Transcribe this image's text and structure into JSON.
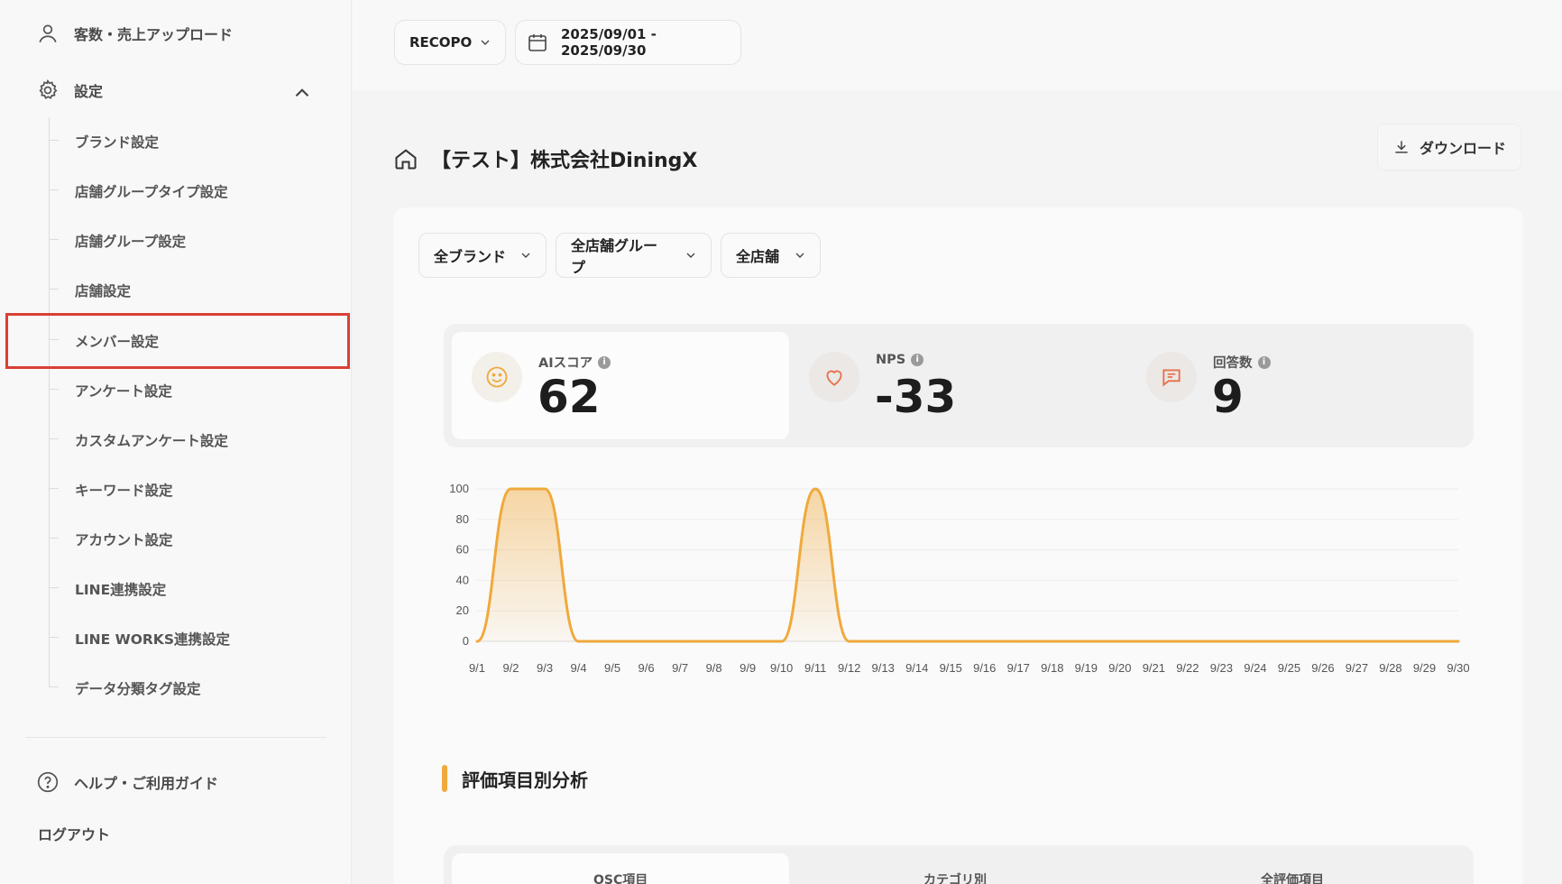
{
  "sidebar": {
    "upload_label": "客数・売上アップロード",
    "settings_label": "設定",
    "sub_items": [
      {
        "label": "ブランド設定"
      },
      {
        "label": "店舗グループタイプ設定"
      },
      {
        "label": "店舗グループ設定"
      },
      {
        "label": "店舗設定"
      },
      {
        "label": "メンバー設定"
      },
      {
        "label": "アンケート設定"
      },
      {
        "label": "カスタムアンケート設定"
      },
      {
        "label": "キーワード設定"
      },
      {
        "label": "アカウント設定"
      },
      {
        "label": "LINE連携設定"
      },
      {
        "label": "LINE WORKS連携設定"
      },
      {
        "label": "データ分類タグ設定"
      }
    ],
    "highlighted_item": "メンバー設定",
    "help_label": "ヘルプ・ご利用ガイド",
    "logout_label": "ログアウト"
  },
  "topbar": {
    "brand_select": "RECOPO",
    "date_range": "2025/09/01 - 2025/09/30"
  },
  "page": {
    "title": "【テスト】株式会社DiningX",
    "download_label": "ダウンロード"
  },
  "filters": {
    "brand": "全ブランド",
    "store_group": "全店舗グループ",
    "store": "全店舗"
  },
  "kpis": [
    {
      "label": "AIスコア",
      "value": "62",
      "icon": "smile-icon",
      "info": "i"
    },
    {
      "label": "NPS",
      "value": "-33",
      "icon": "heart-icon",
      "info": "i"
    },
    {
      "label": "回答数",
      "value": "9",
      "icon": "message-icon",
      "info": "i"
    }
  ],
  "colors": {
    "accent": "#f0a93c",
    "highlight_border": "#d94035",
    "icon_orange": "#e8704a"
  },
  "chart_data": {
    "type": "area",
    "categories": [
      "9/1",
      "9/2",
      "9/3",
      "9/4",
      "9/5",
      "9/6",
      "9/7",
      "9/8",
      "9/9",
      "9/10",
      "9/11",
      "9/12",
      "9/13",
      "9/14",
      "9/15",
      "9/16",
      "9/17",
      "9/18",
      "9/19",
      "9/20",
      "9/21",
      "9/22",
      "9/23",
      "9/24",
      "9/25",
      "9/26",
      "9/27",
      "9/28",
      "9/29",
      "9/30"
    ],
    "values": [
      0,
      100,
      100,
      0,
      0,
      0,
      0,
      0,
      0,
      0,
      100,
      0,
      0,
      0,
      0,
      0,
      0,
      0,
      0,
      0,
      0,
      0,
      0,
      0,
      0,
      0,
      0,
      0,
      0,
      0
    ],
    "ylim": [
      0,
      100
    ],
    "yticks": [
      "0",
      "20",
      "40",
      "60",
      "80",
      "100"
    ],
    "grid": true,
    "color": "#f0a93c"
  },
  "section": {
    "title": "評価項目別分析",
    "tabs": [
      "OSC項目",
      "カテゴリ別",
      "全評価項目"
    ]
  }
}
